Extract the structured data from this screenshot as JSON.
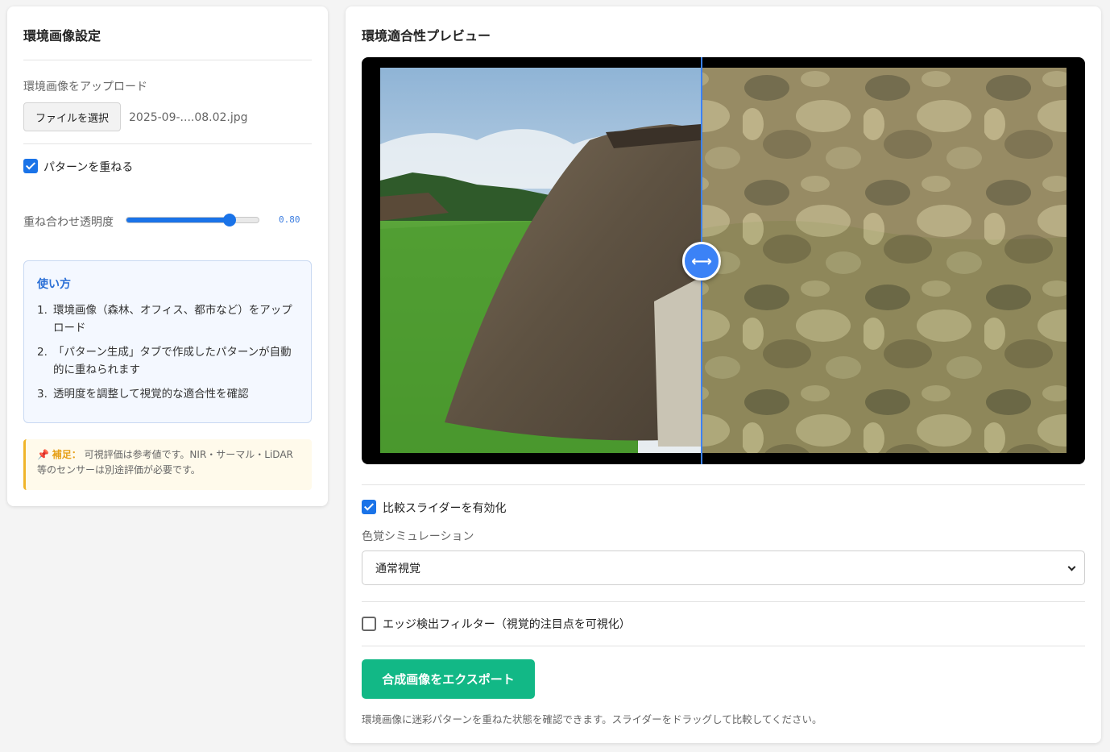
{
  "left_panel": {
    "title": "環境画像設定",
    "upload_label": "環境画像をアップロード",
    "file_button": "ファイルを選択",
    "file_name": "2025-09-....08.02.jpg",
    "overlay_checkbox": {
      "label": "パターンを重ねる",
      "checked": true
    },
    "opacity": {
      "label": "重ね合わせ透明度",
      "value": 0.8,
      "display": "0.80"
    },
    "howto": {
      "title": "使い方",
      "items": [
        {
          "num": "1.",
          "text": "環境画像（森林、オフィス、都市など）をアップロード"
        },
        {
          "num": "2.",
          "text": "「パターン生成」タブで作成したパターンが自動的に重ねられます"
        },
        {
          "num": "3.",
          "text": "透明度を調整して視覚的な適合性を確認"
        }
      ]
    },
    "note": {
      "icon": "pushpin-icon",
      "pin": "📌",
      "heading": "補足：",
      "text": "可視評価は参考値です。NIR・サーマル・LiDAR等のセンサーは別途評価が必要です。"
    }
  },
  "right_panel": {
    "title": "環境適合性プレビュー",
    "preview": {
      "handle_glyph": "⟷",
      "split_fraction": 0.47
    },
    "compare_checkbox": {
      "label": "比較スライダーを有効化",
      "checked": true
    },
    "color_sim": {
      "label": "色覚シミュレーション",
      "selected": "通常視覚"
    },
    "edge_checkbox": {
      "label": "エッジ検出フィルター（視覚的注目点を可視化）",
      "checked": false
    },
    "export_button": "合成画像をエクスポート",
    "footnote": "環境画像に迷彩パターンを重ねた状態を確認できます。スライダーをドラッグして比較してください。"
  },
  "colors": {
    "accent": "#1a73e8",
    "divider": "#3b82f6",
    "export": "#12b886",
    "note_border": "#f0b429"
  }
}
